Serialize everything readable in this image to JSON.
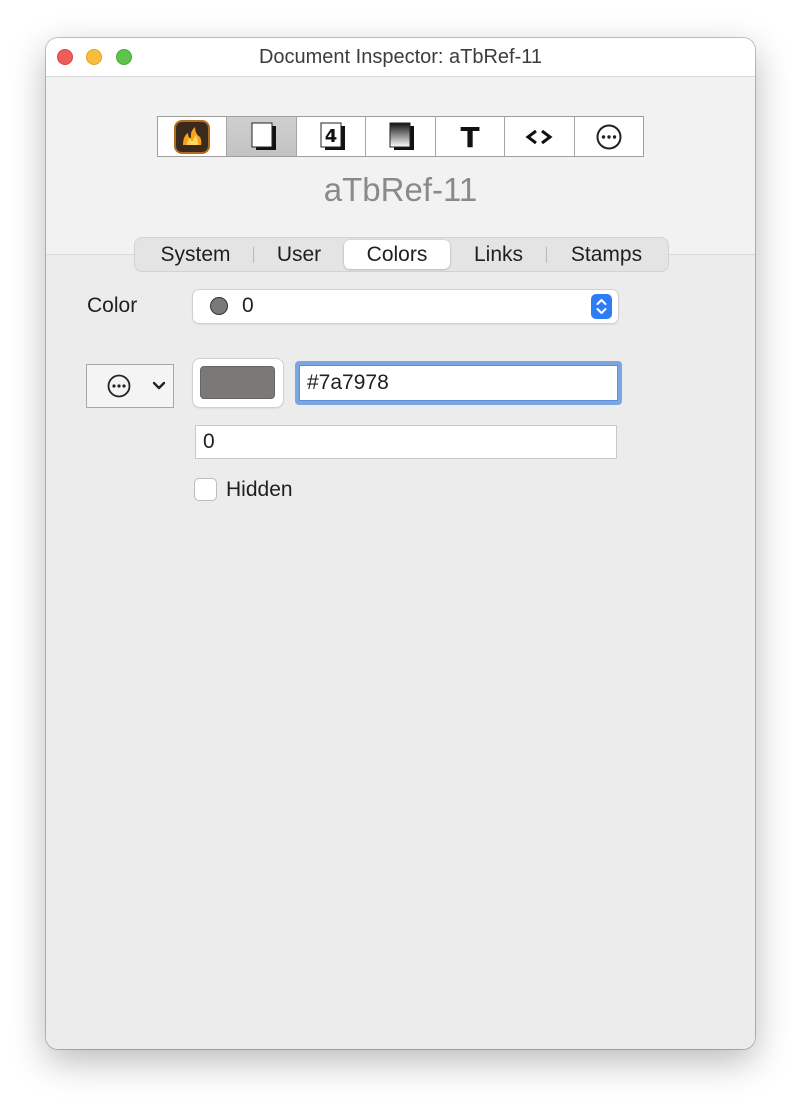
{
  "window": {
    "title": "Document Inspector: aTbRef-11"
  },
  "toolbar": {
    "buttons": [
      {
        "icon": "flame-icon"
      },
      {
        "icon": "document-icon"
      },
      {
        "icon": "number-4-icon"
      },
      {
        "icon": "shaded-document-icon"
      },
      {
        "icon": "text-t-icon"
      },
      {
        "icon": "code-brackets-icon",
        "glyph": "<>"
      },
      {
        "icon": "ellipsis-circle-icon"
      }
    ],
    "active_index": 1
  },
  "document_name": "aTbRef-11",
  "tabs": {
    "items": [
      "System",
      "User",
      "Colors",
      "Links",
      "Stamps"
    ],
    "selected": "Colors"
  },
  "colors": {
    "color_label": "Color",
    "color_popup_value": "0",
    "swatch_color": "#7a7978",
    "hex_value": "#7a7978",
    "number_value": "0",
    "hidden_label": "Hidden",
    "hidden_checked": false
  },
  "accent": "#2e7cf6"
}
